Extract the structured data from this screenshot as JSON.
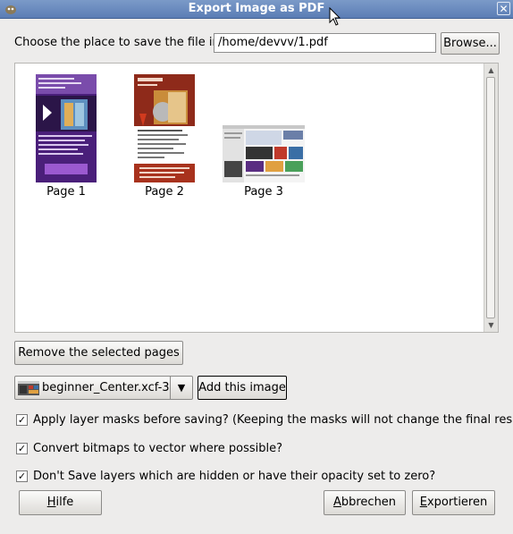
{
  "window": {
    "title": "Export Image as PDF",
    "close_glyph": "✕"
  },
  "location": {
    "label": "Choose the place to save the file in:",
    "path": "/home/devvv/1.pdf",
    "browse": "Browse..."
  },
  "pages": [
    {
      "label": "Page 1"
    },
    {
      "label": "Page 2"
    },
    {
      "label": "Page 3"
    }
  ],
  "remove_button": "Remove the selected pages",
  "image_combo": {
    "selected": "beginner_Center.xcf-3"
  },
  "add_button": "Add this image",
  "options": [
    {
      "label": "Apply layer masks before saving? (Keeping the masks will not change the final result)",
      "checked": true
    },
    {
      "label": "Convert bitmaps to vector where possible?",
      "checked": true
    },
    {
      "label": "Don't Save layers which are hidden or have their opacity set to zero?",
      "checked": true
    }
  ],
  "footer": {
    "help": {
      "pre": "",
      "mnemonic": "H",
      "post": "ilfe"
    },
    "cancel": {
      "pre": "",
      "mnemonic": "A",
      "post": "bbrechen"
    },
    "export": {
      "pre": "",
      "mnemonic": "E",
      "post": "xportieren"
    }
  }
}
